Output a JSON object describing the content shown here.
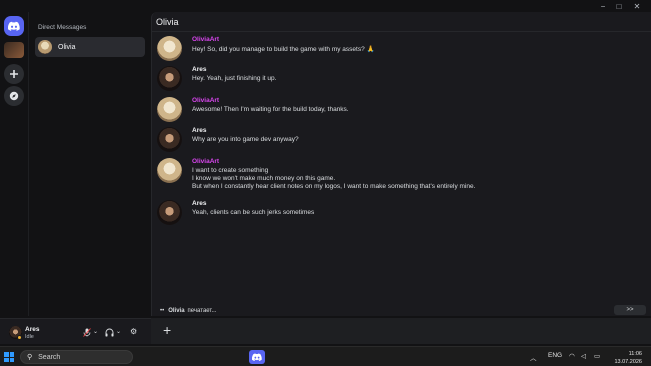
{
  "window": {
    "controls": [
      "−",
      "□",
      "✕"
    ]
  },
  "sidebar": {
    "section_title": "Direct Messages",
    "dm_items": [
      {
        "label": "Olivia"
      }
    ]
  },
  "channel": {
    "title": "Olivia"
  },
  "messages": [
    {
      "author": "OliviaArt",
      "lines": [
        "Hey! So, did you manage to build the game with my assets? 🙏"
      ]
    },
    {
      "author": "Ares",
      "lines": [
        "Hey. Yeah, just finishing it up."
      ]
    },
    {
      "author": "OliviaArt",
      "lines": [
        "Awesome! Then I'm waiting for the build today, thanks."
      ]
    },
    {
      "author": "Ares",
      "lines": [
        "Why are you into game dev anyway?"
      ]
    },
    {
      "author": "OliviaArt",
      "lines": [
        "I want to create something",
        "I know we won't make much money on this game.",
        "But when I constantly hear client notes on my logos, I want to make something that's entirely mine."
      ]
    },
    {
      "author": "Ares",
      "lines": [
        "Yeah, clients can be such jerks sometimes"
      ]
    }
  ],
  "typing": {
    "name": "Olivia",
    "text": "печатает..."
  },
  "next_button": ">>",
  "composer": {
    "plus_label": "+"
  },
  "user_panel": {
    "name": "Ares",
    "status": "Idle"
  },
  "taskbar": {
    "search_label": "Search",
    "language": "ENG",
    "time": "11:06",
    "date": "13.07.2026"
  },
  "colors": {
    "olivia_name": "#d946ef",
    "accent": "#5865f2"
  }
}
